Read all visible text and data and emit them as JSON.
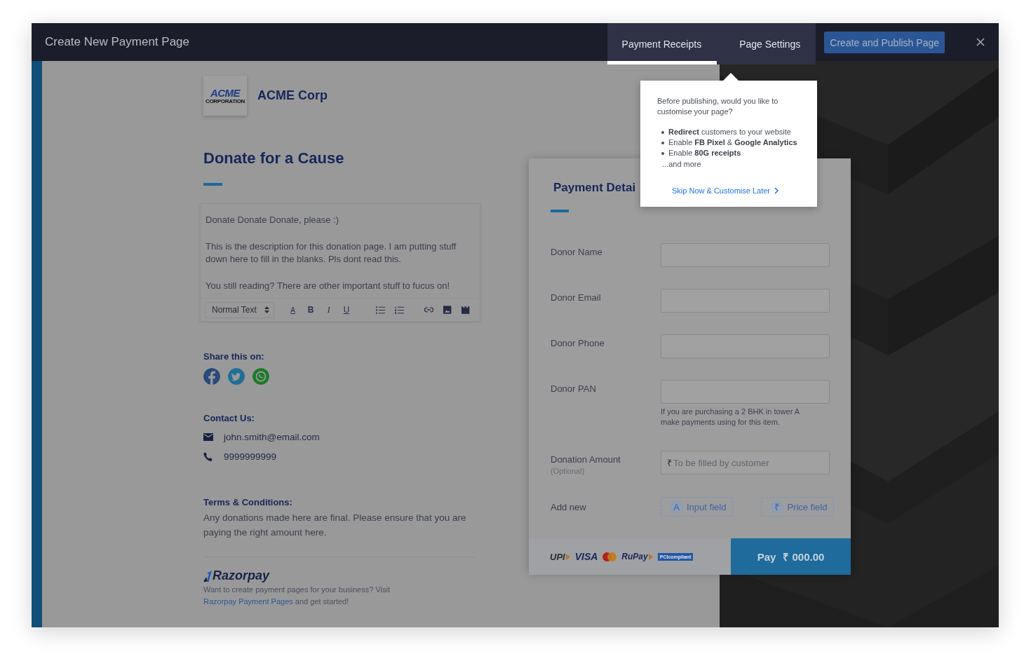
{
  "header": {
    "title": "Create New Payment Page",
    "tabs": [
      {
        "label": "Payment Receipts",
        "selected": true
      },
      {
        "label": "Page Settings",
        "selected": false
      }
    ],
    "publish_button": "Create and Publish Page"
  },
  "brand": {
    "logo_word": "ACME",
    "logo_tagline": "CORPORATION",
    "name": "ACME Corp"
  },
  "page_title": "Donate for a Cause",
  "description": {
    "paragraphs": [
      "Donate Donate Donate, please :)",
      "This is the description for this donation page. I am putting stuff down here to fill in the blanks. Pls dont read this.",
      "You still reading? There are other important stuff to fucus on!"
    ],
    "format": "Normal Text",
    "tools": [
      {
        "kind": "color",
        "label": "A"
      },
      {
        "kind": "bold",
        "label": "B"
      },
      {
        "kind": "italic",
        "label": "I"
      },
      {
        "kind": "underline",
        "label": "U"
      },
      {
        "kind": "bullets"
      },
      {
        "kind": "numbers"
      },
      {
        "kind": "link"
      },
      {
        "kind": "image"
      },
      {
        "kind": "video"
      }
    ]
  },
  "share": {
    "heading": "Share this on:",
    "networks": [
      {
        "kind": "facebook"
      },
      {
        "kind": "twitter"
      },
      {
        "kind": "whatsapp"
      }
    ]
  },
  "contact": {
    "heading": "Contact Us:",
    "items": [
      {
        "kind": "email",
        "text": "john.smith@email.com"
      },
      {
        "kind": "phone",
        "text": "9999999999"
      }
    ]
  },
  "terms": {
    "heading": "Terms & Conditions:",
    "text": "Any donations made here are final. Please ensure that you are paying the right amount here."
  },
  "footer": {
    "logo": "Razorpay",
    "text": "Want to create payment pages for your business? Visit",
    "link": "Razorpay Payment Pages",
    "after": "and get started!"
  },
  "payment_card": {
    "title": "Payment Detai",
    "fields": [
      {
        "label": "Donor Name"
      },
      {
        "label": "Donor Email"
      },
      {
        "label": "Donor Phone"
      },
      {
        "label": "Donor PAN",
        "help": "If you are purchasing a 2 BHK in tower A make payments using for this item."
      },
      {
        "label": "Donation Amount",
        "note": "(Optional)",
        "prefix": "₹",
        "placeholder": "To be filled by customer"
      }
    ],
    "add_new": {
      "label": "Add new",
      "buttons": [
        {
          "icon": "A",
          "label": "Input field"
        },
        {
          "icon": "₹",
          "label": "Price field"
        }
      ]
    },
    "payment_logos": [
      {
        "kind": "upi",
        "text": "UPI"
      },
      {
        "kind": "visa",
        "text": "VISA"
      },
      {
        "kind": "mastercard"
      },
      {
        "kind": "rupay",
        "text": "RuPay"
      },
      {
        "kind": "pci",
        "text": "PCIcompliant"
      }
    ],
    "pay_button": {
      "label": "Pay",
      "amount": "₹ 000.00"
    }
  },
  "popover": {
    "intro": "Before publishing, would you like to customise your page?",
    "bullets": [
      "**Redirect** customers to your website",
      "Enable **FB Pixel** & **Google Analytics**",
      "Enable **80G receipts**"
    ],
    "more": "...and more",
    "link": "Skip Now & Customise Later"
  }
}
